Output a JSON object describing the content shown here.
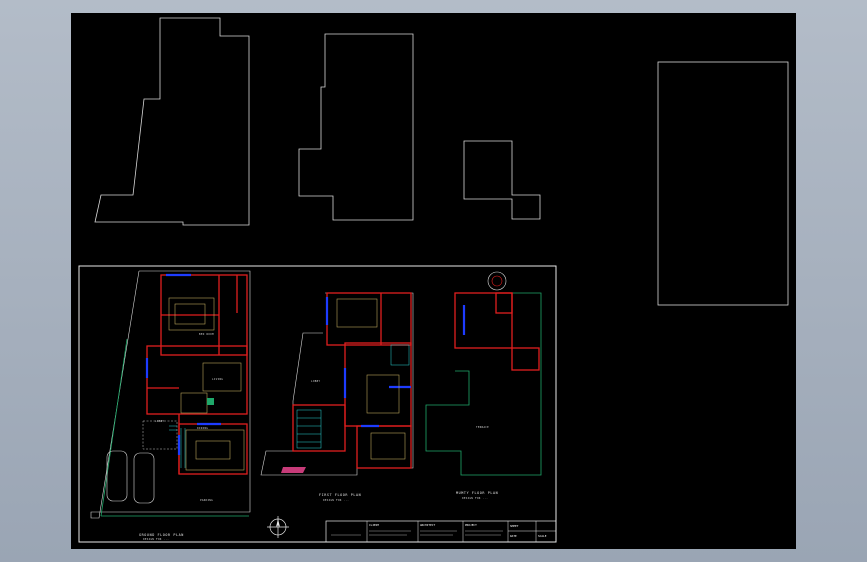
{
  "colors": {
    "background_top": "#b3bcc8",
    "background_bottom": "#9aa5b4",
    "model_space": "#000000",
    "outline": "#d8d8d8",
    "wall_red": "#e01e1e",
    "glazing_blue": "#1e3cff",
    "furniture_tan": "#b8a35a",
    "green_boundary": "#1fa86a",
    "stair_cyan": "#2ad4d4"
  },
  "drawing": {
    "ground_floor_title": "GROUND FLOOR PLAN",
    "ground_floor_sub": "DESIGN FOR ...",
    "first_floor_title": "FIRST FLOOR PLAN",
    "first_floor_sub": "DESIGN FOR ...",
    "mumty_title": "MUMTY FLOOR PLAN",
    "mumty_sub": "DESIGN FOR ...",
    "terrace_label": "TERRACE",
    "parking_label": "PARKING",
    "living_label": "LIVING",
    "bedroom_label": "BED ROOM",
    "kitchen_label": "KITCHEN",
    "lobby_label": "LOBBY",
    "store_label": "STORE",
    "dining_label": "DINING",
    "drawing_label": "DRAWING"
  },
  "title_block": {
    "client_header": "CLIENT",
    "architect_header": "ARCHITECT",
    "project_header": "PROJECT",
    "sheet_header": "SHEET",
    "date_header": "DATE",
    "scale_header": "SCALE"
  },
  "icons": {
    "north_arrow": "compass-north-icon"
  }
}
